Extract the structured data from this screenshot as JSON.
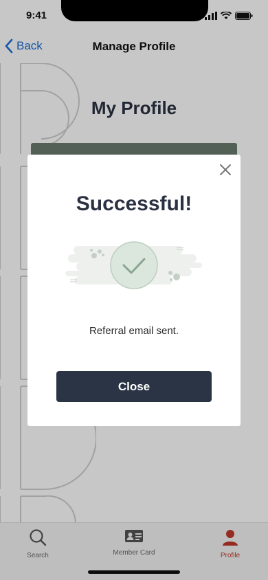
{
  "status_bar": {
    "time": "9:41"
  },
  "nav": {
    "back_label": "Back",
    "title": "Manage Profile"
  },
  "page": {
    "title": "My Profile"
  },
  "modal": {
    "title": "Successful!",
    "message": "Referral email sent.",
    "close_button_label": "Close",
    "close_icon": "close-icon",
    "illustration_icon": "checkmark-icon"
  },
  "tab_bar": {
    "items": [
      {
        "label": "Search",
        "icon": "search-icon",
        "active": false
      },
      {
        "label": "Member Card",
        "icon": "id-card-icon",
        "active": false
      },
      {
        "label": "Profile",
        "icon": "person-icon",
        "active": true
      }
    ]
  },
  "colors": {
    "accent_blue": "#1b6fd6",
    "dark_navy": "#2a3445",
    "active_tab": "#c0392b"
  }
}
